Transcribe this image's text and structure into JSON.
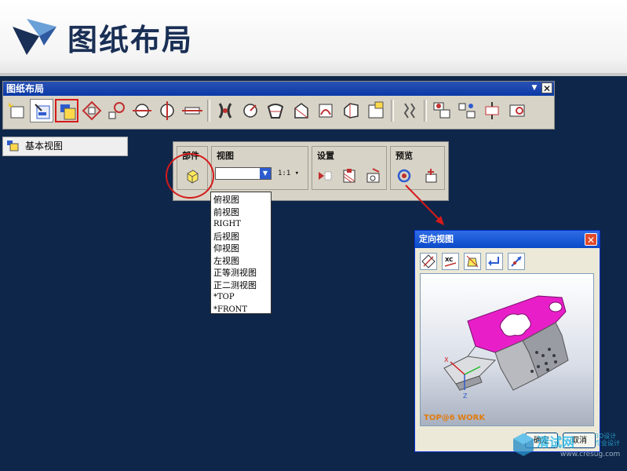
{
  "slide": {
    "title": "图纸布局"
  },
  "layout_window": {
    "title": "图纸布局",
    "close_symbol": "✕",
    "dropdown_symbol": "▼",
    "icons": [
      "new-sheet-icon",
      "open-sheet-icon",
      "base-view-icon",
      "projected-view-icon",
      "detail-view-icon",
      "section-view-icon",
      "half-section-icon",
      "revolved-section-icon",
      "broken-view-icon",
      "move-view-icon",
      "copy-view-icon",
      "align-view-icon",
      "view-boundary-icon",
      "edit-view-icon",
      "update-view-icon",
      "display-view-icon",
      "break-line-icon",
      "view-dependent-icon",
      "sheet-icon",
      "edit-sheet-icon",
      "preferences-icon"
    ]
  },
  "base_view_item": {
    "label": "基本视图"
  },
  "base_view_toolbar": {
    "groups": {
      "part": "部件",
      "view": "视图",
      "settings": "设置",
      "preview": "预览"
    },
    "scale": "1:1 ▾",
    "select_value": ""
  },
  "view_dropdown": {
    "options": [
      "俯视图",
      "前视图",
      "RIGHT",
      "后视图",
      "仰视图",
      "左视图",
      "正等测视图",
      "正二测视图",
      "*TOP",
      "*FRONT"
    ]
  },
  "orient_dialog": {
    "title": "定向视图",
    "close_symbol": "✕",
    "toolbar": [
      "orient-view-icon",
      "xc-axis-icon",
      "specify-vector-icon",
      "reverse-icon",
      "rotate-view-icon"
    ],
    "xc_label": "XC",
    "viewport_label": "TOP@6 WORK",
    "axis_labels": {
      "x": "X",
      "z": "Z"
    },
    "ok": "确定",
    "cancel": "取消"
  },
  "watermark": {
    "name": "清试网",
    "sub": "3D设计\n专业设计",
    "url": "www.cresug.com"
  },
  "colors": {
    "background": "#0e2649",
    "title_blue": "#1a2f55",
    "highlight_red": "#d51a1a",
    "part_magenta": "#e81fc9",
    "label_orange": "#e07c10"
  }
}
